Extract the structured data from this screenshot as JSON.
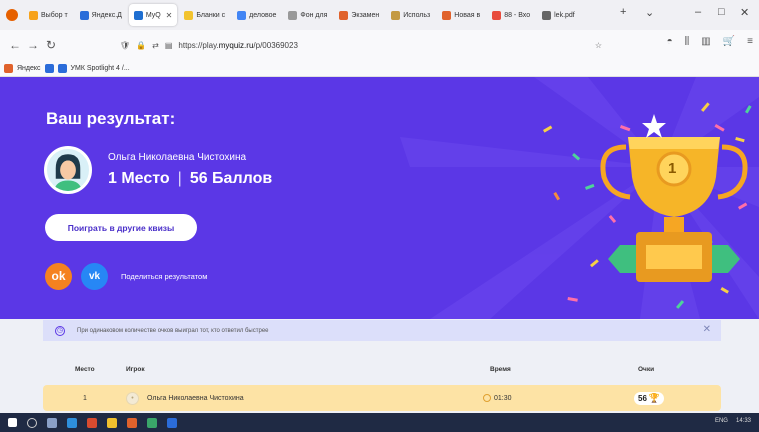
{
  "browser": {
    "tabs": [
      {
        "label": "Выбор т",
        "color": "#f7a31c"
      },
      {
        "label": "Яндекс.Д",
        "color": "#2a6dd9"
      },
      {
        "label": "MyQ",
        "color": "#1f6fd1"
      },
      {
        "label": "Бланки с",
        "color": "#f2c32e"
      },
      {
        "label": "деловое",
        "color": "#4285f4"
      },
      {
        "label": "Фон для",
        "color": "#999999"
      },
      {
        "label": "Экзамен",
        "color": "#e0622c"
      },
      {
        "label": "Использ",
        "color": "#c49a42"
      },
      {
        "label": "Новая в",
        "color": "#e0622c"
      },
      {
        "label": "88 - Вхо",
        "color": "#e84c3d"
      },
      {
        "label": "lek.pdf",
        "color": "#666666"
      }
    ],
    "url_prefix": "https://play.",
    "url_domain": "myquiz.ru",
    "url_path": "/p/00369023",
    "bookmarks": [
      {
        "label": "Яндекс",
        "color": "#e0622c"
      },
      {
        "label": "",
        "color": "#2b6cd9"
      },
      {
        "label": "УМК Spotlight 4 /...",
        "color": "#2b6cd9"
      }
    ]
  },
  "hero": {
    "title": "Ваш результат:",
    "player_name": "Ольга Николаевна Чистохина",
    "place": "1 Место",
    "separator": "|",
    "score": "56 Баллов",
    "play_button": "Поиграть в другие квизы",
    "ok_glyph": "ok",
    "vk_glyph": "vk",
    "share_label": "Поделиться результатом",
    "trophy_number": "1"
  },
  "results": {
    "info_text": "При одинаковом количестве очков выиграл тот, кто ответил быстрее",
    "columns": {
      "place": "Место",
      "player": "Игрок",
      "time": "Время",
      "score": "Очки"
    },
    "rows": [
      {
        "place": "1",
        "player": "Ольга Николаевна Чистохина",
        "time": "01:30",
        "score": "56"
      }
    ]
  },
  "taskbar": {
    "lang": "ENG",
    "time": "14:33"
  },
  "colors": {
    "hero_bg": "#5b37e6",
    "accent_yellow": "#fde3a5",
    "info_bar": "#dcdffa"
  }
}
